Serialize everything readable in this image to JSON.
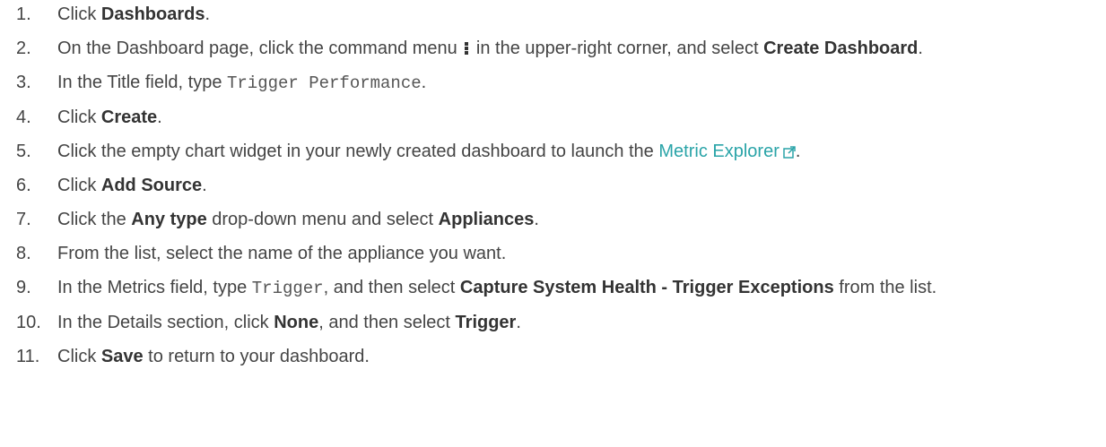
{
  "steps": [
    {
      "num": "1.",
      "a": "Click ",
      "b": "Dashboards",
      "c": "."
    },
    {
      "num": "2.",
      "a": "On the Dashboard page, click the command menu ",
      "b": " in the upper-right corner, and select ",
      "bold": "Create Dashboard",
      "c": "."
    },
    {
      "num": "3.",
      "a": "In the Title field, type ",
      "code": "Trigger Performance",
      "c": "."
    },
    {
      "num": "4.",
      "a": "Click ",
      "b": "Create",
      "c": "."
    },
    {
      "num": "5.",
      "a": "Click the empty chart widget in your newly created dashboard to launch the ",
      "link": "Metric Explorer",
      "c": "."
    },
    {
      "num": "6.",
      "a": "Click ",
      "b": "Add Source",
      "c": "."
    },
    {
      "num": "7.",
      "a": "Click the ",
      "b1": "Any type",
      "mid": " drop-down menu and select ",
      "b2": "Appliances",
      "c": "."
    },
    {
      "num": "8.",
      "a": "From the list, select the name of the appliance you want."
    },
    {
      "num": "9.",
      "a": "In the Metrics field, type ",
      "code": "Trigger",
      "mid": ", and then select ",
      "b": "Capture System Health - Trigger Exceptions",
      "c": " from the list."
    },
    {
      "num": "10.",
      "a": "In the Details section, click ",
      "b1": "None",
      "mid": ", and then select ",
      "b2": "Trigger",
      "c": "."
    },
    {
      "num": "11.",
      "a": "Click ",
      "b": "Save",
      "c": " to return to your dashboard."
    }
  ],
  "icons": {
    "command": "vertical-dots-icon",
    "external": "external-link-icon"
  },
  "colors": {
    "text": "#444444",
    "link": "#2aa4a8"
  }
}
